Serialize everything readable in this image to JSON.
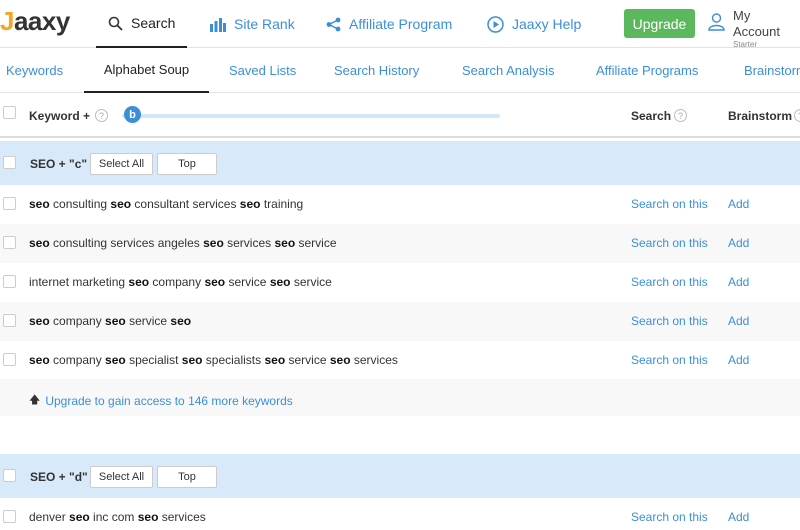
{
  "app": {
    "logo": "Jaaxy"
  },
  "topnav": {
    "items": [
      {
        "label": "Search",
        "icon": "search-icon"
      },
      {
        "label": "Site Rank",
        "icon": "bar-chart-icon"
      },
      {
        "label": "Affiliate Program",
        "icon": "share-icon"
      },
      {
        "label": "Jaaxy Help",
        "icon": "play-circle-icon"
      }
    ],
    "upgrade_label": "Upgrade",
    "account_name": "My Account",
    "account_plan": "Starter"
  },
  "subnav": {
    "items": [
      "Keywords",
      "Alphabet Soup",
      "Saved Lists",
      "Search History",
      "Search Analysis",
      "Affiliate Programs",
      "Brainstorm"
    ],
    "active": "Alphabet Soup"
  },
  "table_header": {
    "keyword_label": "Keyword +",
    "slider_letter": "b",
    "search_label": "Search",
    "brainstorm_label": "Brainstorm",
    "help_glyph": "?"
  },
  "groups": [
    {
      "label": "SEO + \"c\"",
      "select_all": "Select All",
      "top": "Top",
      "rows": [
        [
          [
            "seo",
            true
          ],
          [
            " consulting ",
            false
          ],
          [
            "seo",
            true
          ],
          [
            " consultant services ",
            false
          ],
          [
            "seo",
            true
          ],
          [
            " training",
            false
          ]
        ],
        [
          [
            "seo",
            true
          ],
          [
            " consulting services angeles ",
            false
          ],
          [
            "seo",
            true
          ],
          [
            " services ",
            false
          ],
          [
            "seo",
            true
          ],
          [
            " service",
            false
          ]
        ],
        [
          [
            "internet marketing ",
            false
          ],
          [
            "seo",
            true
          ],
          [
            " company ",
            false
          ],
          [
            "seo",
            true
          ],
          [
            " service ",
            false
          ],
          [
            "seo",
            true
          ],
          [
            " service",
            false
          ]
        ],
        [
          [
            "seo",
            true
          ],
          [
            " company ",
            false
          ],
          [
            "seo",
            true
          ],
          [
            " service ",
            false
          ],
          [
            "seo",
            true
          ]
        ],
        [
          [
            "seo",
            true
          ],
          [
            " company ",
            false
          ],
          [
            "seo",
            true
          ],
          [
            " specialist ",
            false
          ],
          [
            "seo",
            true
          ],
          [
            " specialists ",
            false
          ],
          [
            "seo",
            true
          ],
          [
            " service ",
            false
          ],
          [
            "seo",
            true
          ],
          [
            " services",
            false
          ]
        ]
      ],
      "upgrade_text": "Upgrade to gain access to 146 more keywords"
    },
    {
      "label": "SEO + \"d\"",
      "select_all": "Select All",
      "top": "Top",
      "rows": [
        [
          [
            "denver ",
            false
          ],
          [
            "seo",
            true
          ],
          [
            " inc com ",
            false
          ],
          [
            "seo",
            true
          ],
          [
            " services",
            false
          ]
        ]
      ]
    }
  ],
  "row_actions": {
    "search_label": "Search on this",
    "add_label": "Add"
  }
}
